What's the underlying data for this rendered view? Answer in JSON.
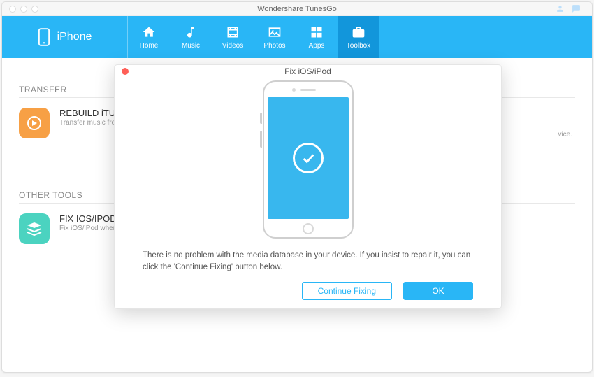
{
  "app": {
    "title": "Wondershare TunesGo"
  },
  "device": {
    "name": "iPhone"
  },
  "nav": {
    "home": "Home",
    "music": "Music",
    "videos": "Videos",
    "photos": "Photos",
    "apps": "Apps",
    "toolbox": "Toolbox",
    "active": "toolbox"
  },
  "sections": {
    "transfer": {
      "title": "TRANSFER",
      "card1": {
        "title": "REBUILD iTUNES LIBRARY",
        "sub": "Transfer music from your device to iTunes or computer, including Music, Playlists...",
        "sub_trail": "vice."
      }
    },
    "other": {
      "title": "OTHER TOOLS",
      "card1": {
        "title": "FIX IOS/IPOD",
        "sub": "Fix iOS/iPod when your music library cannot be recognized."
      }
    }
  },
  "modal": {
    "title": "Fix iOS/iPod",
    "message": "There is no problem with the media database in your device. If you insist to repair it, you can click the 'Continue Fixing' button below.",
    "continue_label": "Continue Fixing",
    "ok_label": "OK"
  }
}
